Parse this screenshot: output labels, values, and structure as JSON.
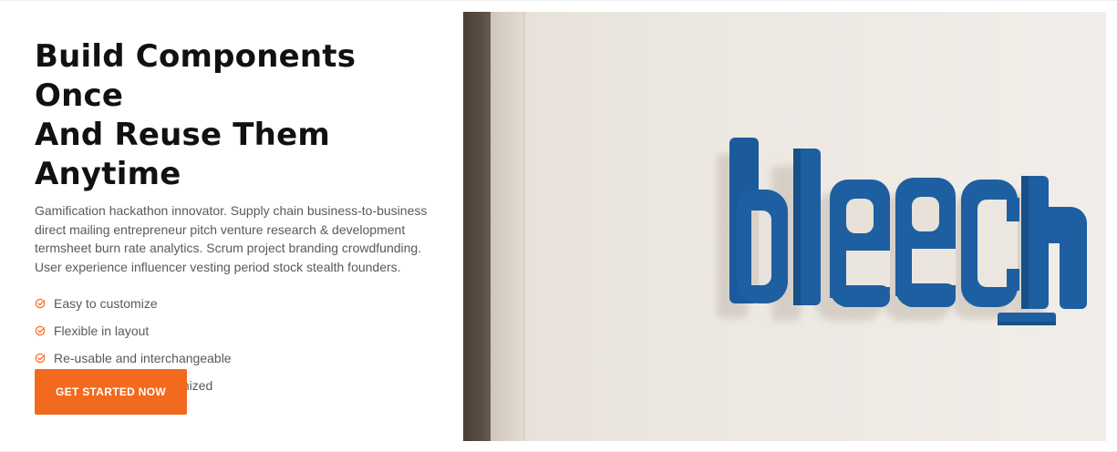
{
  "hero": {
    "headline": {
      "line1": "Build Components Once",
      "line2": "And Reuse Them",
      "line3": "Anytime"
    },
    "description": "Gamification hackathon innovator. Supply chain business-to-business direct mailing entrepreneur pitch venture research & development termsheet burn rate analytics. Scrum project branding crowdfunding. User experience influencer vesting period stock stealth founders.",
    "features": [
      "Easy to customize",
      "Flexible in layout",
      "Re-usable and interchangeable",
      "Lightning fast and optimized"
    ],
    "cta_label": "GET STARTED NOW"
  },
  "photo": {
    "sign_text": "bleech"
  },
  "colors": {
    "accent": "#f26a1e",
    "heading": "#111111",
    "body_text": "#555a60",
    "sign_blue": "#1d5fa0"
  },
  "icons": {
    "feature_check": "check-circle-icon"
  }
}
